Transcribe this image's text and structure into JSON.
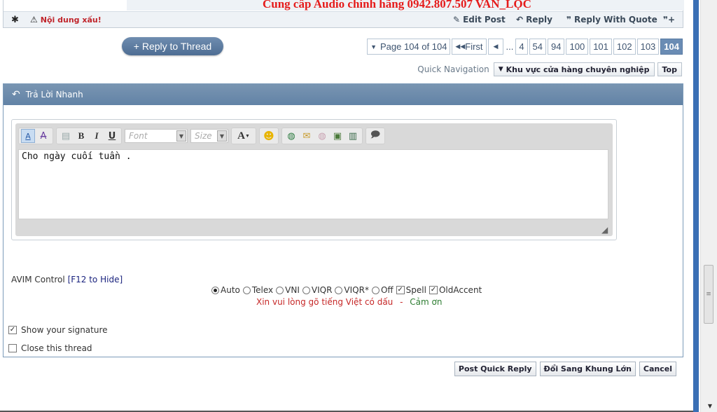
{
  "promo": {
    "text": "Cung cấp Audio chính hãng 0942.807.507 VAN_LỌC"
  },
  "post_actions": {
    "report_label": "Nội dung xấu!",
    "edit_label": "Edit Post",
    "reply_label": "Reply",
    "reply_quote_label": "Reply With Quote"
  },
  "thread": {
    "reply_button": "+ Reply to Thread"
  },
  "pagination": {
    "page_label": "Page 104 of 104",
    "first_label": "First",
    "ellipsis": "...",
    "pages": [
      "4",
      "54",
      "94",
      "100",
      "101",
      "102",
      "103"
    ],
    "current": "104"
  },
  "quick_nav": {
    "label": "Quick Navigation",
    "selected": "Khu vực cửa hàng chuyên nghiệp",
    "top_label": "Top"
  },
  "quick_reply": {
    "title": "Trả Lời Nhanh",
    "font_placeholder": "Font",
    "size_placeholder": "Size",
    "message": "Cho ngày cuối tuần ."
  },
  "avim": {
    "label": "AVIM Control",
    "hotkey": "[F12 to Hide]",
    "options": [
      "Auto",
      "Telex",
      "VNI",
      "VIQR",
      "VIQR*",
      "Off"
    ],
    "selected": "Auto",
    "checkboxes": [
      "Spell",
      "OldAccent"
    ],
    "notice": "Xin vui lòng gõ tiếng Việt có dấu",
    "separator": "-",
    "thanks": "Cảm ơn"
  },
  "options": {
    "show_signature": "Show your signature",
    "show_signature_checked": true,
    "close_thread": "Close this thread",
    "close_thread_checked": false
  },
  "buttons": {
    "post_quick_reply": "Post Quick Reply",
    "switch_advanced": "Đổi Sang Khung Lớn",
    "cancel": "Cancel"
  },
  "colors": {
    "header_blue": "#6a8cb4",
    "promo_red": "#e51b1b",
    "report_red": "#c0242a"
  }
}
